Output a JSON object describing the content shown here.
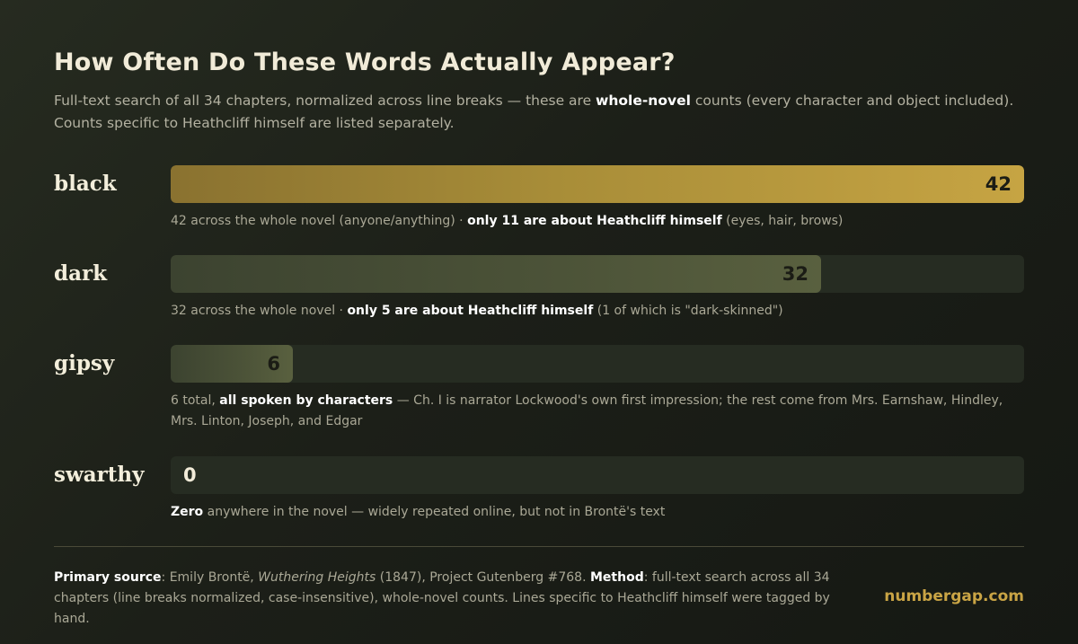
{
  "title": "How Often Do These Words Actually Appear?",
  "subtitle": {
    "pre": "Full-text search of all 34 chapters, normalized across line breaks — these are ",
    "bold": "whole-novel",
    "post": " counts (every character and object included). Counts specific to Heathcliff himself are listed separately."
  },
  "chart_data": {
    "type": "bar",
    "orientation": "horizontal",
    "categories": [
      "black",
      "dark",
      "gipsy",
      "swarthy"
    ],
    "values": [
      42,
      32,
      6,
      0
    ],
    "xlim": [
      0,
      42
    ],
    "value_labels": [
      "42",
      "32",
      "6",
      "0"
    ],
    "colors": {
      "highlight": "#c6a443",
      "bar": "#4c5338",
      "track": "#262c22"
    }
  },
  "rows": [
    {
      "word": "black",
      "value_label": "42",
      "note": [
        {
          "t": "42 across the whole novel (anyone/anything) · "
        },
        {
          "t": "only 11 are about Heathcliff himself",
          "b": true
        },
        {
          "t": " (eyes, hair, brows)"
        }
      ]
    },
    {
      "word": "dark",
      "value_label": "32",
      "note": [
        {
          "t": "32 across the whole novel · "
        },
        {
          "t": "only 5 are about Heathcliff himself",
          "b": true
        },
        {
          "t": " (1 of which is \"dark-skinned\")"
        }
      ]
    },
    {
      "word": "gipsy",
      "value_label": "6",
      "note": [
        {
          "t": "6 total, "
        },
        {
          "t": "all spoken by characters",
          "b": true
        },
        {
          "t": " — Ch. I is narrator Lockwood's own first impression; the rest come from Mrs. Earnshaw, Hindley, Mrs. Linton, Joseph, and Edgar"
        }
      ]
    },
    {
      "word": "swarthy",
      "value_label": "0",
      "note": [
        {
          "t": "Zero",
          "b": true
        },
        {
          "t": " anywhere in the novel — widely repeated online, but not in Brontë's text"
        }
      ]
    }
  ],
  "footer": [
    {
      "t": "Primary source",
      "b": true
    },
    {
      "t": ": Emily Brontë, "
    },
    {
      "t": "Wuthering Heights",
      "i": true
    },
    {
      "t": " (1847), Project Gutenberg #768. "
    },
    {
      "t": "Method",
      "b": true
    },
    {
      "t": ": full-text search across all 34 chapters (line breaks normalized, case-insensitive), whole-novel counts. Lines specific to Heathcliff himself were tagged by hand."
    }
  ],
  "brand": "numbergap.com"
}
